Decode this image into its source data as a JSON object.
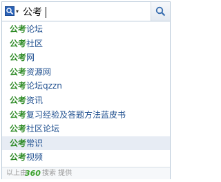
{
  "search": {
    "engine_icon": "magnifier-engine-icon",
    "caret": "▾",
    "value": "公考",
    "button_icon": "search-icon"
  },
  "suggestions": [
    {
      "keyword": "公考",
      "rest": "论坛"
    },
    {
      "keyword": "公考",
      "rest": "社区"
    },
    {
      "keyword": "公考",
      "rest": "网"
    },
    {
      "keyword": "公考",
      "rest": "资源网"
    },
    {
      "keyword": "公考",
      "rest": "论坛qzzn"
    },
    {
      "keyword": "公考",
      "rest": "资讯"
    },
    {
      "keyword": "公考",
      "rest": "复习经验及答题方法蓝皮书"
    },
    {
      "keyword": "公考",
      "rest": "社区论坛"
    },
    {
      "keyword": "公考",
      "rest": "常识"
    },
    {
      "keyword": "公考",
      "rest": "视频"
    }
  ],
  "footer": {
    "prefix": "以上由",
    "brand": "360",
    "suffix": "搜索 提供"
  },
  "colors": {
    "keyword": "#2d8a25",
    "suggestion_text": "#1f4f8f",
    "selected_row": "#e7ecf4",
    "brand": "#3aa12c"
  }
}
